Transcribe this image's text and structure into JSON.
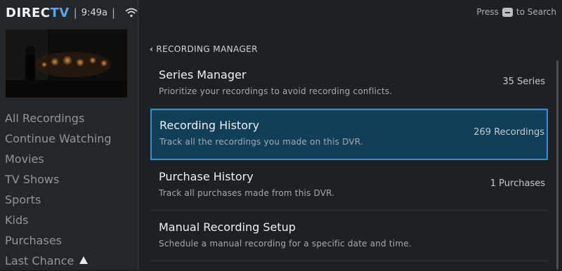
{
  "status_bar": {
    "brand_main": "DIREC",
    "brand_accent": "TV",
    "separator": "|",
    "time": "9:49a",
    "wifi_icon": "wifi-icon"
  },
  "search_hint": {
    "prefix": "Press",
    "suffix": "to Search",
    "button_icon": "minus-button-icon"
  },
  "sidebar": {
    "items": [
      {
        "label": "All Recordings"
      },
      {
        "label": "Continue Watching"
      },
      {
        "label": "Movies"
      },
      {
        "label": "TV Shows"
      },
      {
        "label": "Sports"
      },
      {
        "label": "Kids"
      },
      {
        "label": "Purchases"
      },
      {
        "label": "Last Chance",
        "icon": "warning-icon"
      }
    ]
  },
  "breadcrumb": {
    "label": "RECORDING MANAGER",
    "icon": "chevron-left-icon"
  },
  "menu": {
    "rows": [
      {
        "title": "Series Manager",
        "description": "Prioritize your recordings to avoid recording conflicts.",
        "count": "35 Series"
      },
      {
        "title": "Recording History",
        "description": "Track all the recordings you made on this DVR.",
        "count": "269 Recordings",
        "selected": true
      },
      {
        "title": "Purchase History",
        "description": "Track all purchases made from this DVR.",
        "count": "1 Purchases"
      },
      {
        "title": "Manual Recording Setup",
        "description": "Schedule a manual recording for a specific date and time.",
        "count": ""
      }
    ]
  },
  "colors": {
    "accent": "#2f8fe3",
    "selected_bg": "#113f57",
    "background": "#1e2124",
    "brand_tv": "#5aa6e6"
  }
}
